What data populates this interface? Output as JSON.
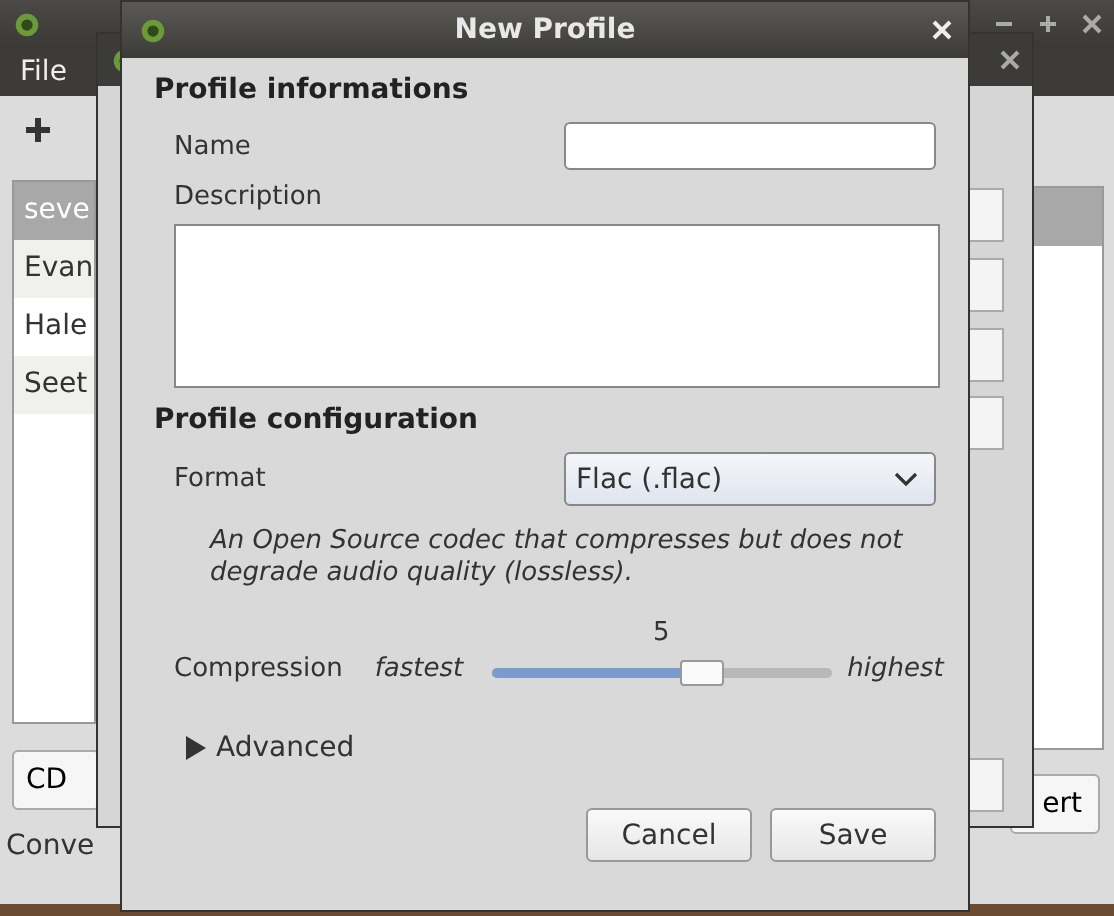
{
  "main_window": {
    "menu": [
      "File"
    ],
    "list": [
      {
        "label": "seve",
        "selected": true
      },
      {
        "label": "Evan",
        "selected": false
      },
      {
        "label": "Hale",
        "selected": false
      },
      {
        "label": "Seet",
        "selected": false
      }
    ],
    "left_button": "CD",
    "right_button": "ert",
    "status_bar": "Conve"
  },
  "dialog": {
    "title": "New Profile",
    "info_section": "Profile informations",
    "name_label": "Name",
    "description_label": "Description",
    "config_section": "Profile configuration",
    "format_label": "Format",
    "format_value": "Flac (.flac)",
    "format_description": "An Open Source codec that compresses but does not degrade audio quality (lossless).",
    "compression": {
      "label": "Compression",
      "min_label": "fastest",
      "max_label": "highest",
      "value": "5",
      "level": 0.62
    },
    "advanced": {
      "label": "Advanced",
      "expanded": false
    },
    "buttons": [
      "Cancel",
      "Save"
    ]
  }
}
